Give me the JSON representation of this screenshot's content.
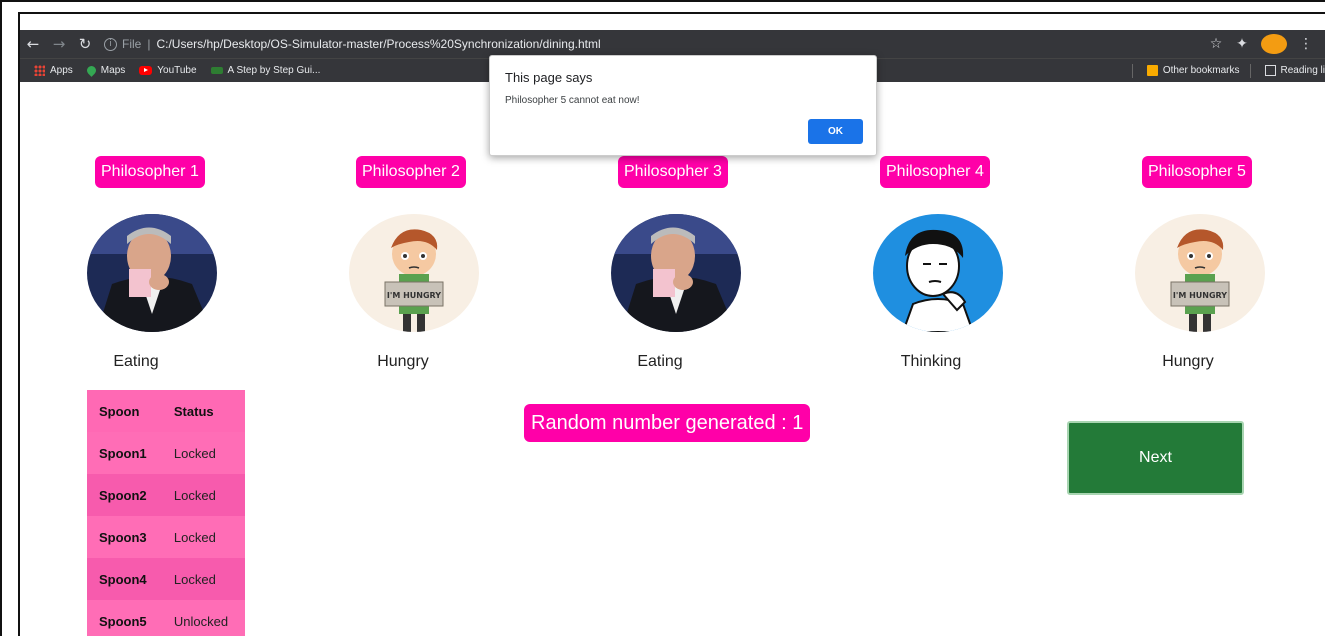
{
  "browser": {
    "file_label": "File",
    "separator": "|",
    "url": "C:/Users/hp/Desktop/OS-Simulator-master/Process%20Synchronization/dining.html",
    "bookmarks": [
      {
        "label": "Apps",
        "icon": "apps-grid-icon"
      },
      {
        "label": "Maps",
        "icon": "maps-pin-icon"
      },
      {
        "label": "YouTube",
        "icon": "youtube-icon"
      },
      {
        "label": "A Step by Step Gui...",
        "icon": "bookmark-site-icon"
      }
    ],
    "other_bookmarks": "Other bookmarks",
    "reading_list": "Reading li"
  },
  "dialog": {
    "title": "This page says",
    "message": "Philosopher 5 cannot eat now!",
    "ok_label": "OK"
  },
  "philosophers": [
    {
      "name": "Philosopher 1",
      "state": "Eating",
      "image": "eating-man-icon"
    },
    {
      "name": "Philosopher 2",
      "state": "Hungry",
      "image": "hungry-boy-icon"
    },
    {
      "name": "Philosopher 3",
      "state": "Eating",
      "image": "eating-man-icon"
    },
    {
      "name": "Philosopher 4",
      "state": "Thinking",
      "image": "thinking-man-icon"
    },
    {
      "name": "Philosopher 5",
      "state": "Hungry",
      "image": "hungry-boy-icon"
    }
  ],
  "spoon_table": {
    "headers": [
      "Spoon",
      "Status"
    ],
    "rows": [
      {
        "spoon": "Spoon1",
        "status": "Locked"
      },
      {
        "spoon": "Spoon2",
        "status": "Locked"
      },
      {
        "spoon": "Spoon3",
        "status": "Locked"
      },
      {
        "spoon": "Spoon4",
        "status": "Locked"
      },
      {
        "spoon": "Spoon5",
        "status": "Unlocked"
      }
    ]
  },
  "random_text": "Random number generated : 1",
  "next_label": "Next",
  "colors": {
    "accent_pink": "#ff00a8",
    "next_green": "#237a38",
    "ok_blue": "#1a73e8",
    "chrome_dark": "#35363a"
  }
}
